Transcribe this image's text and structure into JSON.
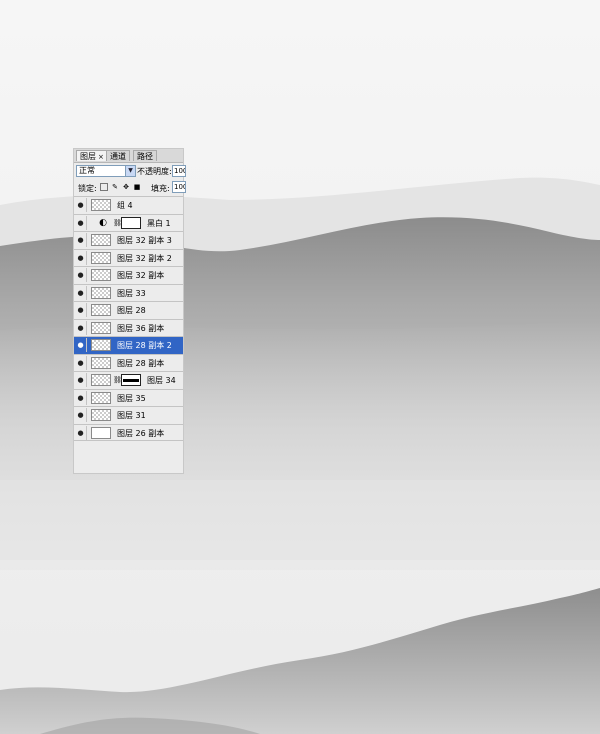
{
  "panel": {
    "tabs": [
      {
        "label": "图层",
        "close": "×"
      },
      {
        "label": "通道"
      },
      {
        "label": "路径"
      }
    ],
    "blend_mode": "正常",
    "opacity_label": "不透明度:",
    "opacity_value": "100",
    "lock_label": "锁定:",
    "fill_label": "填充:",
    "fill_value": "100",
    "layers": [
      {
        "name": "组 4",
        "type": "group"
      },
      {
        "name": "黑白 1",
        "type": "adjustment"
      },
      {
        "name": "图层 32 副本 3",
        "type": "normal"
      },
      {
        "name": "图层 32 副本 2",
        "type": "normal"
      },
      {
        "name": "图层 32 副本",
        "type": "normal"
      },
      {
        "name": "图层 33",
        "type": "normal"
      },
      {
        "name": "图层 28",
        "type": "normal"
      },
      {
        "name": "图层 36 副本",
        "type": "normal"
      },
      {
        "name": "图层 28 副本 2",
        "type": "normal",
        "selected": true
      },
      {
        "name": "图层 28 副本",
        "type": "normal"
      },
      {
        "name": "图层 34",
        "type": "masked"
      },
      {
        "name": "图层 35",
        "type": "normal"
      },
      {
        "name": "图层 31",
        "type": "normal"
      },
      {
        "name": "图层 26 副本",
        "type": "white"
      }
    ]
  },
  "colors": {
    "selection": "#3165c5",
    "panel_bg": "#ececec",
    "canvas_bg": "#f2f2f2",
    "mountain": "#8a8a8a"
  }
}
